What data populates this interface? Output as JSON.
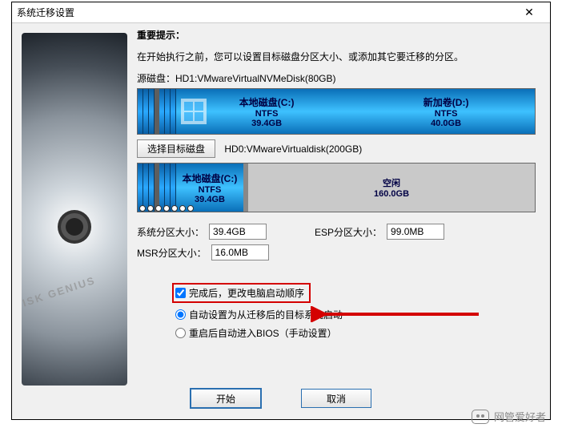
{
  "window": {
    "title": "系统迁移设置"
  },
  "hint": {
    "title": "重要提示：",
    "text": "在开始执行之前，您可以设置目标磁盘分区大小、或添加其它要迁移的分区。"
  },
  "source": {
    "label": "源磁盘：",
    "disk": "HD1:VMwareVirtualNVMeDisk(80GB)",
    "partitions": [
      {
        "name": "本地磁盘(C:)",
        "fs": "NTFS",
        "size": "39.4GB"
      },
      {
        "name": "新加卷(D:)",
        "fs": "NTFS",
        "size": "40.0GB"
      }
    ]
  },
  "target": {
    "select_btn": "选择目标磁盘",
    "disk": "HD0:VMwareVirtualdisk(200GB)",
    "partitions": [
      {
        "name": "本地磁盘(C:)",
        "fs": "NTFS",
        "size": "39.4GB"
      }
    ],
    "free": {
      "name": "空闲",
      "size": "160.0GB"
    }
  },
  "fields": {
    "sys_label": "系统分区大小：",
    "sys_value": "39.4GB",
    "esp_label": "ESP分区大小：",
    "esp_value": "99.0MB",
    "msr_label": "MSR分区大小：",
    "msr_value": "16.0MB"
  },
  "options": {
    "check_label": "完成后，更改电脑启动顺序",
    "radio1": "自动设置为从迁移后的目标系统启动",
    "radio2": "重启后自动进入BIOS（手动设置）"
  },
  "buttons": {
    "start": "开始",
    "cancel": "取消"
  },
  "watermark": "网管爱好者"
}
